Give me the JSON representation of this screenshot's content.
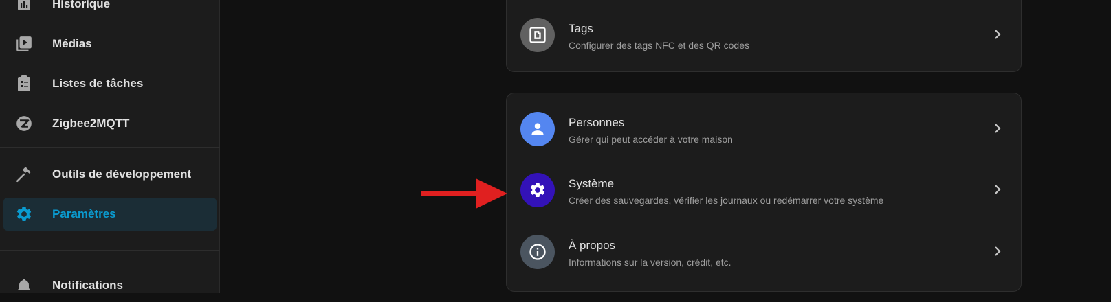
{
  "sidebar": {
    "items": [
      {
        "label": "Historique",
        "icon": "chart-box-icon"
      },
      {
        "label": "Médias",
        "icon": "play-box-multiple-icon"
      },
      {
        "label": "Listes de tâches",
        "icon": "clipboard-list-icon"
      },
      {
        "label": "Zigbee2MQTT",
        "icon": "zigbee-icon"
      },
      {
        "label": "Outils de développement",
        "icon": "hammer-icon"
      },
      {
        "label": "Paramètres",
        "icon": "gear-icon",
        "active": true
      },
      {
        "label": "Notifications",
        "icon": "bell-icon"
      }
    ]
  },
  "settings": {
    "tags": {
      "title": "Tags",
      "subtitle": "Configurer des tags NFC et des QR codes",
      "icon": "nfc-tag-icon",
      "color": "#616161"
    },
    "persons": {
      "title": "Personnes",
      "subtitle": "Gérer qui peut accéder à votre maison",
      "icon": "person-icon",
      "color": "#5486f0"
    },
    "system": {
      "title": "Système",
      "subtitle": "Créer des sauvegardes, vérifier les journaux ou redémarrer votre système",
      "icon": "gear-icon",
      "color": "#3312b8"
    },
    "about": {
      "title": "À propos",
      "subtitle": "Informations sur la version, crédit, etc.",
      "icon": "info-icon",
      "color": "#4b5560"
    }
  },
  "colors": {
    "accent": "#0a9bd0",
    "arrow": "#e02020",
    "background": "#111111",
    "card": "#1c1c1c"
  }
}
